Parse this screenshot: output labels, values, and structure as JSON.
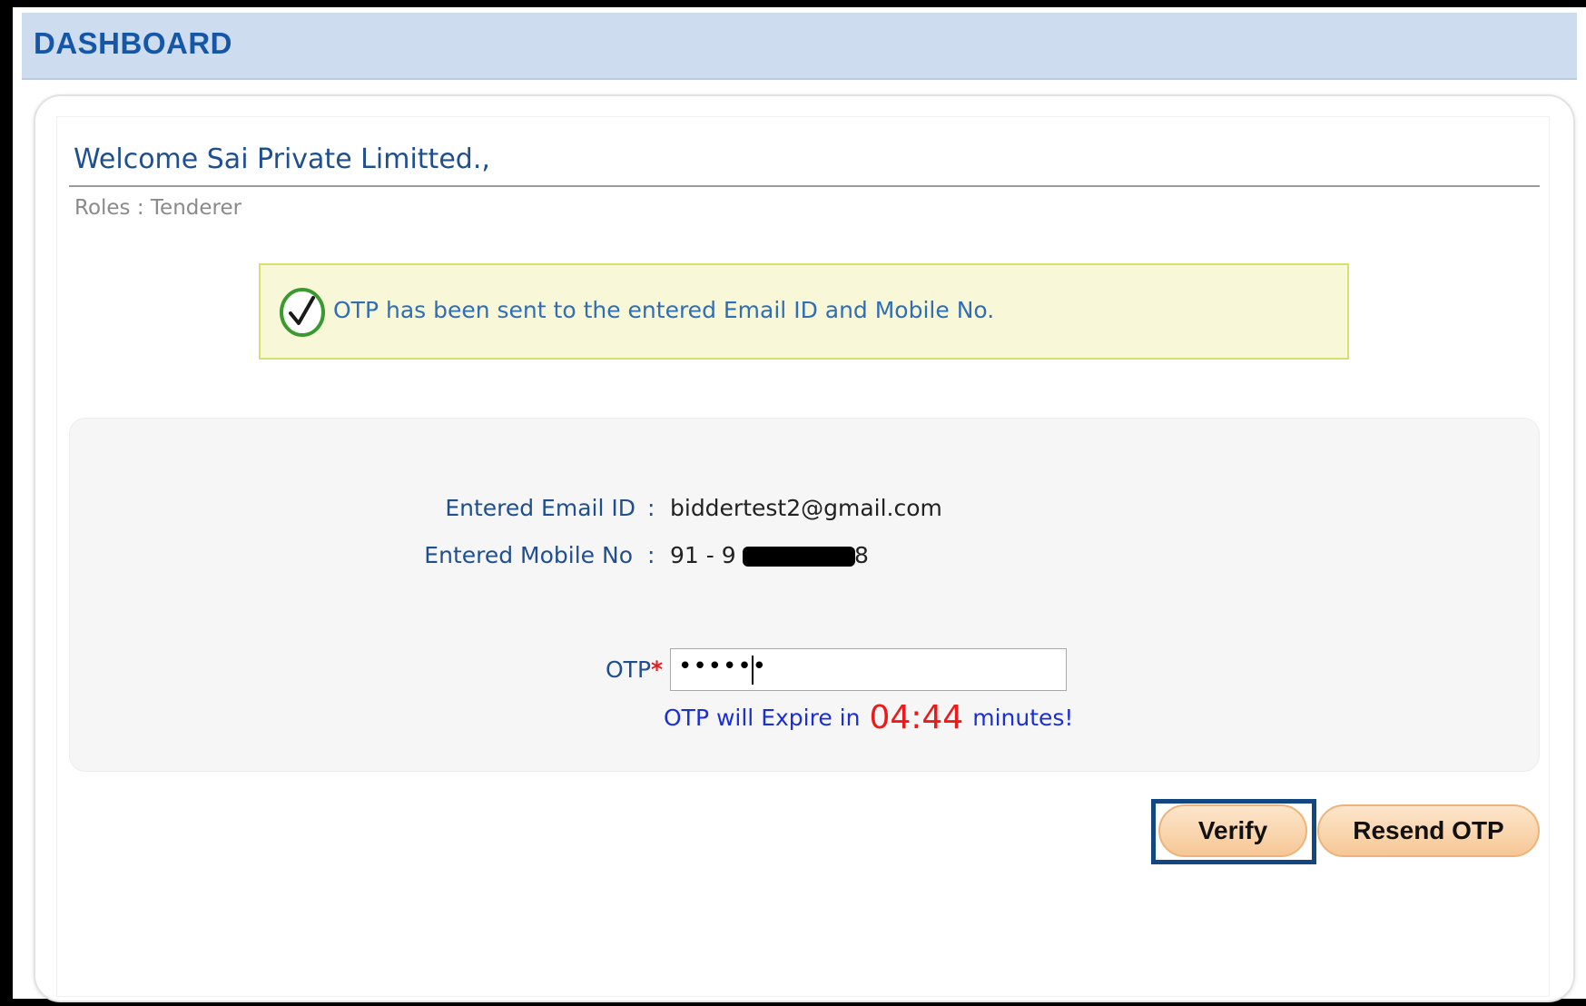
{
  "header": {
    "title": "DASHBOARD"
  },
  "welcome": {
    "title": "Welcome Sai Private Limitted.,",
    "roles": "Roles : Tenderer"
  },
  "notice": {
    "icon": "check-circle-icon",
    "message": "OTP has been sent to the entered Email ID and Mobile No."
  },
  "details": {
    "email_label": "Entered Email ID",
    "email_value": "biddertest2@gmail.com",
    "mobile_label": "Entered Mobile No",
    "mobile_prefix": "91 - 9",
    "mobile_suffix": "8",
    "separator": ":"
  },
  "otp": {
    "label": "OTP",
    "required_mark": "*",
    "value": "••••••",
    "expire_prefix": "OTP will Expire in",
    "expire_time": "04:44",
    "expire_suffix": "minutes!"
  },
  "buttons": {
    "verify": "Verify",
    "resend": "Resend OTP"
  },
  "colors": {
    "header_bg": "#cddcee",
    "header_text": "#1557a6",
    "notice_bg": "#f8f8d9",
    "button_bg": "#f6c796",
    "focus_border": "#124782",
    "timer_red": "#ee1a1a"
  }
}
